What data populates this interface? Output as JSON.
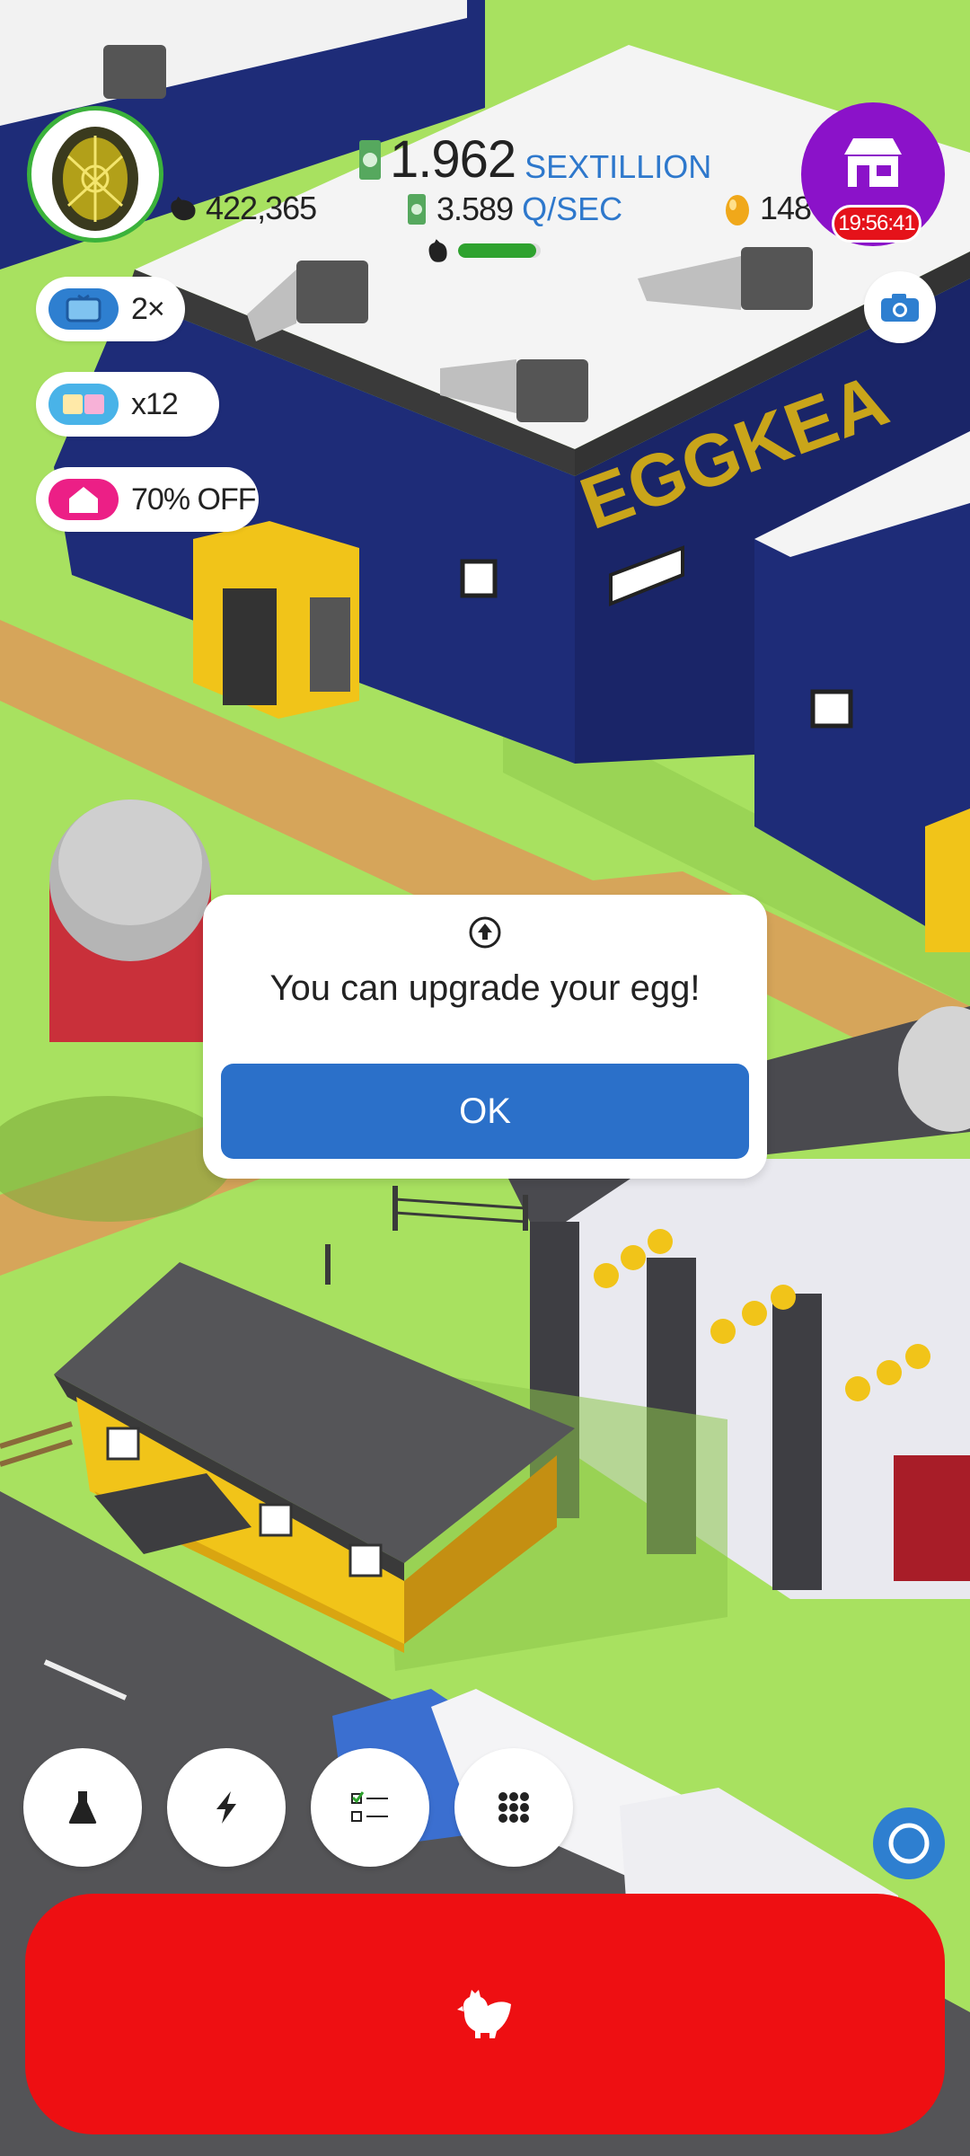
{
  "header": {
    "cash_amount": "1.962",
    "cash_unit": "SEXTILLION",
    "rate_amount": "3.589",
    "rate_unit": "Q/SEC",
    "chicken_count": "422,365",
    "golden_eggs": "148",
    "shop_timer": "19:56:41",
    "progress_fraction": 0.95
  },
  "boosts": {
    "video_multiplier": "2×",
    "boost_count": "x12",
    "discount": "70% OFF"
  },
  "scene": {
    "building_sign": "EGGKEA"
  },
  "dialog": {
    "message": "You can upgrade your egg!",
    "ok_label": "OK"
  },
  "colors": {
    "grass": "#a8e160",
    "road": "#d6a55a",
    "building_blue": "#1e2c78",
    "brand_yellow": "#f1c419",
    "shop_purple": "#8b12c9",
    "timer_red": "#e5121a",
    "hatch_red": "#ee0f12",
    "ok_blue": "#2b70c9"
  },
  "icons": [
    "egg-icon",
    "chicken-icon",
    "cash-icon",
    "golden-egg-icon",
    "shop-icon",
    "camera-icon",
    "tv-icon",
    "boost-icon",
    "house-icon",
    "research-icon",
    "lightning-icon",
    "checklist-icon",
    "grid-icon",
    "circle-icon",
    "hatch-chicken-icon",
    "upgrade-arrow-icon"
  ]
}
